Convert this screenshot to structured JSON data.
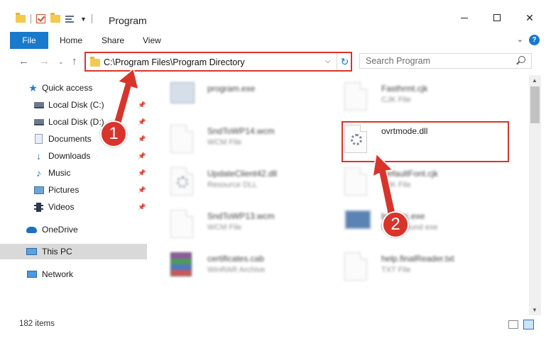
{
  "window": {
    "title": "Program",
    "min_symbol": "",
    "close_symbol": "✕"
  },
  "ribbon": {
    "tabs": [
      "File",
      "Home",
      "Share",
      "View"
    ]
  },
  "address": {
    "path": "C:\\Program Files\\Program Directory",
    "dropdown_symbol": "⌵",
    "refresh_symbol": "↻"
  },
  "search": {
    "placeholder": "Search Program"
  },
  "sidebar": {
    "items": [
      {
        "label": "Quick access",
        "icon": "star-icon"
      },
      {
        "label": "Local Disk (C:)",
        "icon": "disk-icon",
        "pinned": true
      },
      {
        "label": "Local Disk (D:)",
        "icon": "disk-icon",
        "pinned": true
      },
      {
        "label": "Documents",
        "icon": "documents-icon",
        "pinned": true
      },
      {
        "label": "Downloads",
        "icon": "download-icon",
        "pinned": true
      },
      {
        "label": "Music",
        "icon": "music-icon",
        "pinned": true
      },
      {
        "label": "Pictures",
        "icon": "pictures-icon",
        "pinned": true
      },
      {
        "label": "Videos",
        "icon": "videos-icon",
        "pinned": true
      },
      {
        "label": "OneDrive",
        "icon": "cloud-icon"
      },
      {
        "label": "This PC",
        "icon": "pc-icon",
        "selected": true
      },
      {
        "label": "Network",
        "icon": "network-icon"
      }
    ]
  },
  "files": [
    {
      "name": "program.exe",
      "type": "",
      "icon": "exe-icon",
      "blurred": true
    },
    {
      "name": "Fasthrmt.cjk",
      "type": "CJK File",
      "icon": "page-icon",
      "blurred": true
    },
    {
      "name": "SndToWP14.wcm",
      "type": "WCM File",
      "icon": "page-icon",
      "blurred": true
    },
    {
      "name": "ovrtmode.dll",
      "type": "",
      "icon": "dll-gear-icon",
      "blurred": false
    },
    {
      "name": "UpdateClient42.dll",
      "type": "Resource DLL",
      "icon": "dll-gear-icon",
      "blurred": true
    },
    {
      "name": "DefaultFont.cjk",
      "type": "CJK File",
      "icon": "page-icon",
      "blurred": true
    },
    {
      "name": "SndToWP13.wcm",
      "type": "WCM File",
      "icon": "page-icon",
      "blurred": true
    },
    {
      "name": "bgexec.exe",
      "type": "Background exe",
      "icon": "bg-icon",
      "blurred": true
    },
    {
      "name": "certificates.cab",
      "type": "WinRAR Archive",
      "icon": "rar-icon",
      "blurred": true
    },
    {
      "name": "help.finalReader.txt",
      "type": "TXT File",
      "icon": "page-icon",
      "blurred": true
    }
  ],
  "status": {
    "item_count": "182 items"
  },
  "annotations": {
    "badge1": "1",
    "badge2": "2",
    "color": "#d9342b"
  }
}
